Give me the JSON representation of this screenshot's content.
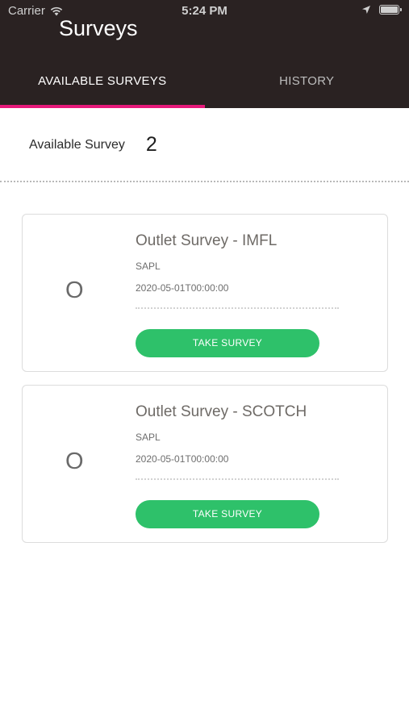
{
  "status_bar": {
    "carrier": "Carrier",
    "time": "5:24 PM",
    "icons": [
      "wifi-icon",
      "location-arrow-icon",
      "battery-icon"
    ]
  },
  "header": {
    "title": "Surveys"
  },
  "tabs": [
    {
      "label": "AVAILABLE SURVEYS",
      "active": true
    },
    {
      "label": "HISTORY",
      "active": false
    }
  ],
  "summary": {
    "label": "Available Survey",
    "count": "2"
  },
  "colors": {
    "header_bg": "#2a2222",
    "tab_indicator": "#e6197a",
    "button": "#2ec16a"
  },
  "surveys": [
    {
      "avatar": "O",
      "title": "Outlet Survey - IMFL",
      "org": "SAPL",
      "date": "2020-05-01T00:00:00",
      "button_label": "TAKE SURVEY"
    },
    {
      "avatar": "O",
      "title": "Outlet Survey - SCOTCH",
      "org": "SAPL",
      "date": "2020-05-01T00:00:00",
      "button_label": "TAKE SURVEY"
    }
  ]
}
